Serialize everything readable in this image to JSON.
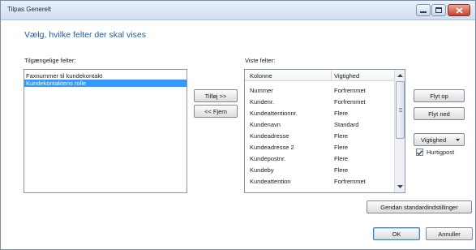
{
  "window": {
    "title": "Tilpas Generelt"
  },
  "dialog": {
    "heading": "Vælg, hvilke felter der skal vises",
    "available_label": "Tilgængelige felter:",
    "shown_label": "Viste felter:",
    "available_fields": [
      {
        "label": "Faxnummer til kundekontakt",
        "selected": false
      },
      {
        "label": "Kundekontaktens rolle",
        "selected": true
      }
    ],
    "add_button": "Tilføj >>",
    "remove_button": "<< Fjern",
    "columns": {
      "col1": "Kolonne",
      "col2": "Vigtighed"
    },
    "shown_fields": [
      {
        "name": "Nummer",
        "priority": "Forfremmet"
      },
      {
        "name": "Kundenr.",
        "priority": "Forfremmet"
      },
      {
        "name": "Kundeattentionnr.",
        "priority": "Flere"
      },
      {
        "name": "Kundenavn",
        "priority": "Standard"
      },
      {
        "name": "Kundeadresse",
        "priority": "Flere"
      },
      {
        "name": "Kundeadresse 2",
        "priority": "Flere"
      },
      {
        "name": "Kundepostnr.",
        "priority": "Flere"
      },
      {
        "name": "Kundeby",
        "priority": "Flere"
      },
      {
        "name": "Kundeattention",
        "priority": "Forfremmet"
      }
    ],
    "move_up_button": "Flyt op",
    "move_down_button": "Flyt ned",
    "priority_dropdown": "Vigtighed",
    "quickpost_label": "Hurtigpost",
    "quickpost_checked": true,
    "restore_button": "Gendan standardindstillinger",
    "ok_button": "OK",
    "cancel_button": "Annuller"
  },
  "icons": {
    "minimize": "minimize-icon",
    "maximize": "maximize-icon",
    "close": "close-icon",
    "scroll_up": "scroll-up-arrow-icon",
    "scroll_down": "scroll-down-arrow-icon",
    "dropdown": "dropdown-arrow-icon",
    "check": "check-icon"
  },
  "colors": {
    "heading": "#1e5fa8",
    "selection": "#3399ff",
    "close_button": "#c5412b"
  }
}
